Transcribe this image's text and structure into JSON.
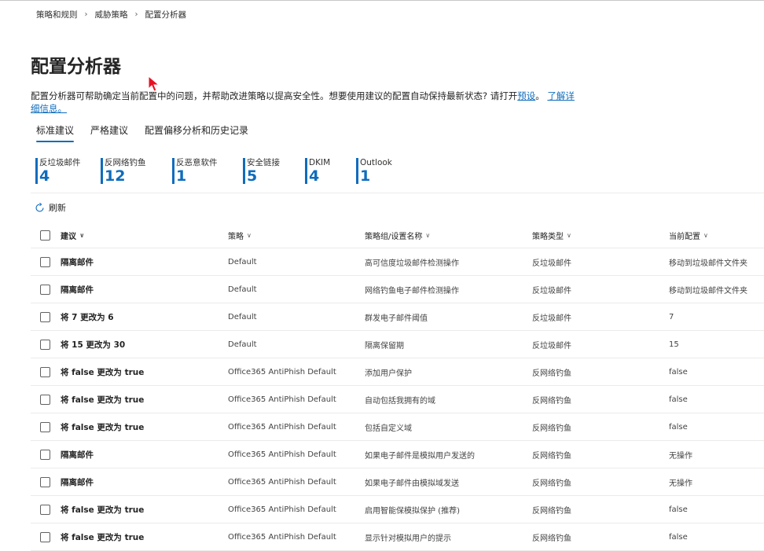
{
  "breadcrumb": [
    "策略和规则",
    "威胁策略",
    "配置分析器"
  ],
  "page_title": "配置分析器",
  "description": {
    "text": "配置分析器可帮助确定当前配置中的问题，并帮助改进策略以提高安全性。想要使用建议的配置自动保持最新状态? 请打开",
    "link1": "预设",
    "sep": "。",
    "link2": "了解详细信息。"
  },
  "tabs": [
    "标准建议",
    "严格建议",
    "配置偏移分析和历史记录"
  ],
  "stats": [
    {
      "label": "反垃圾邮件",
      "value": "4"
    },
    {
      "label": "反网络钓鱼",
      "value": "12"
    },
    {
      "label": "反恶意软件",
      "value": "1"
    },
    {
      "label": "安全链接",
      "value": "5"
    },
    {
      "label": "DKIM",
      "value": "4"
    },
    {
      "label": "Outlook",
      "value": "1"
    }
  ],
  "refresh_label": "刷新",
  "columns": [
    "建议",
    "策略",
    "策略组/设置名称",
    "策略类型",
    "当前配置"
  ],
  "rows": [
    {
      "rec": "隔离邮件",
      "policy": "Default",
      "setting": "高可信度垃圾邮件检测操作",
      "type": "反垃圾邮件",
      "current": "移动到垃圾邮件文件夹"
    },
    {
      "rec": "隔离邮件",
      "policy": "Default",
      "setting": "网络钓鱼电子邮件检测操作",
      "type": "反垃圾邮件",
      "current": "移动到垃圾邮件文件夹"
    },
    {
      "rec": "将 7 更改为 6",
      "policy": "Default",
      "setting": "群发电子邮件阈值",
      "type": "反垃圾邮件",
      "current": "7"
    },
    {
      "rec": "将 15 更改为 30",
      "policy": "Default",
      "setting": "隔离保留期",
      "type": "反垃圾邮件",
      "current": "15"
    },
    {
      "rec": "将 false 更改为 true",
      "policy": "Office365 AntiPhish Default",
      "setting": "添加用户保护",
      "type": "反网络钓鱼",
      "current": "false"
    },
    {
      "rec": "将 false 更改为 true",
      "policy": "Office365 AntiPhish Default",
      "setting": "自动包括我拥有的域",
      "type": "反网络钓鱼",
      "current": "false"
    },
    {
      "rec": "将 false 更改为 true",
      "policy": "Office365 AntiPhish Default",
      "setting": "包括自定义域",
      "type": "反网络钓鱼",
      "current": "false"
    },
    {
      "rec": "隔离邮件",
      "policy": "Office365 AntiPhish Default",
      "setting": "如果电子邮件是模拟用户发送的",
      "type": "反网络钓鱼",
      "current": "无操作"
    },
    {
      "rec": "隔离邮件",
      "policy": "Office365 AntiPhish Default",
      "setting": "如果电子邮件由模拟域发送",
      "type": "反网络钓鱼",
      "current": "无操作"
    },
    {
      "rec": "将 false 更改为 true",
      "policy": "Office365 AntiPhish Default",
      "setting": "启用智能保模拟保护 (推荐)",
      "type": "反网络钓鱼",
      "current": "false"
    },
    {
      "rec": "将 false 更改为 true",
      "policy": "Office365 AntiPhish Default",
      "setting": "显示针对模拟用户的提示",
      "type": "反网络钓鱼",
      "current": "false"
    }
  ],
  "colors": {
    "accent": "#0f6cbd",
    "divider": "#edebe9",
    "cursor": "#e81123"
  }
}
